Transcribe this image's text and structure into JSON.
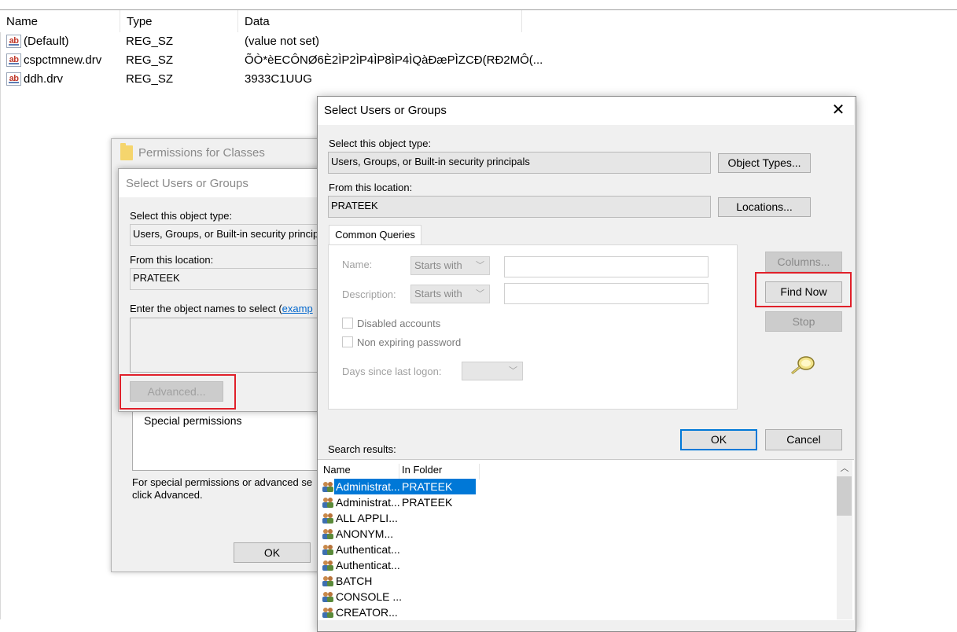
{
  "registry": {
    "columns": [
      "Name",
      "Type",
      "Data"
    ],
    "rows": [
      {
        "name": "(Default)",
        "type": "REG_SZ",
        "data": "(value not set)"
      },
      {
        "name": "cspctmnew.drv",
        "type": "REG_SZ",
        "data": "ÕÒ*èECÔNØ6È2ÌP2ÌP4ÌP8ÌP4ÌQàÐæPÌZCÐ(RÐ2MÔ(..."
      },
      {
        "name": "ddh.drv",
        "type": "REG_SZ",
        "data": "3933C1UUG"
      }
    ],
    "icon": "ab-string-icon"
  },
  "permissions_dialog": {
    "title": "Permissions for Classes",
    "special_permissions_label": "Special permissions",
    "note_line1": "For special permissions or advanced se",
    "note_line2": "click Advanced.",
    "ok_label": "OK"
  },
  "background_select_dialog": {
    "title": "Select Users or Groups",
    "object_type_label": "Select this object type:",
    "object_type_value": "Users, Groups, or Built-in security princip",
    "location_label": "From this location:",
    "location_value": "PRATEEK",
    "enter_names_label": "Enter the object names to select (",
    "examples_link": "examp",
    "advanced_label": "Advanced..."
  },
  "dialog": {
    "title": "Select Users or Groups",
    "close_icon": "close-icon",
    "object_type_label": "Select this object type:",
    "object_type_value": "Users, Groups, or Built-in security principals",
    "object_types_button": "Object Types...",
    "location_label": "From this location:",
    "location_value": "PRATEEK",
    "locations_button": "Locations...",
    "tab_label": "Common Queries",
    "name_label": "Name:",
    "name_mode": "Starts with",
    "description_label": "Description:",
    "description_mode": "Starts with",
    "disabled_accounts_label": "Disabled accounts",
    "non_expiring_label": "Non expiring password",
    "days_since_logon_label": "Days since last logon:",
    "columns_button": "Columns...",
    "find_now_button": "Find Now",
    "stop_button": "Stop",
    "search_icon": "search-magnifier-icon",
    "ok_button": "OK",
    "cancel_button": "Cancel",
    "search_results_label": "Search results:",
    "results_columns": [
      "Name",
      "In Folder"
    ],
    "results": [
      {
        "name": "Administrat...",
        "folder": "PRATEEK",
        "selected": true,
        "icon": "user-icon"
      },
      {
        "name": "Administrat...",
        "folder": "PRATEEK",
        "selected": false,
        "icon": "group-icon"
      },
      {
        "name": "ALL APPLI...",
        "folder": "",
        "selected": false,
        "icon": "group-icon"
      },
      {
        "name": "ANONYM...",
        "folder": "",
        "selected": false,
        "icon": "group-icon"
      },
      {
        "name": "Authenticat...",
        "folder": "",
        "selected": false,
        "icon": "group-icon"
      },
      {
        "name": "Authenticat...",
        "folder": "",
        "selected": false,
        "icon": "group-icon"
      },
      {
        "name": "BATCH",
        "folder": "",
        "selected": false,
        "icon": "group-icon"
      },
      {
        "name": "CONSOLE ...",
        "folder": "",
        "selected": false,
        "icon": "group-icon"
      },
      {
        "name": "CREATOR...",
        "folder": "",
        "selected": false,
        "icon": "group-icon"
      }
    ]
  },
  "colors": {
    "highlight_red": "#e0202a",
    "selection_blue": "#0078d7",
    "dialog_bg": "#f0f0f0"
  }
}
